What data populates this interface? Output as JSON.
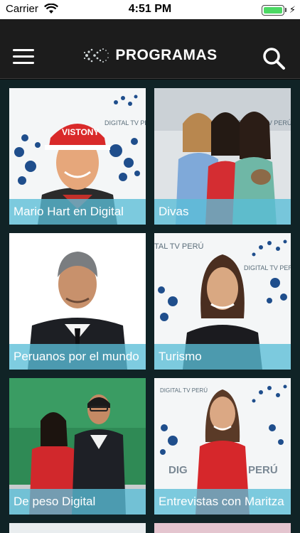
{
  "status_bar": {
    "carrier": "Carrier",
    "time": "4:51 PM",
    "battery_level": 1.0
  },
  "header": {
    "title": "PROGRAMAS",
    "menu_icon": "hamburger-icon",
    "search_icon": "search-icon"
  },
  "programs": [
    {
      "label": "Mario Hart en Digital",
      "watermark": "DIGITAL TV PERÚ"
    },
    {
      "label": "Divas",
      "watermark": "DIGITAL TV PERÚ"
    },
    {
      "label": "Peruanos por el mundo"
    },
    {
      "label": "Turismo",
      "watermark": "DIGITAL TV PERÚ"
    },
    {
      "label": "De peso Digital"
    },
    {
      "label": "Entrevistas con Maritza",
      "watermark": "DIGITAL TV PERÚ"
    }
  ],
  "colors": {
    "nav_bg": "#1c1c1c",
    "grid_bg": "#102326",
    "label_overlay": "#5abed7",
    "battery": "#4cd964"
  }
}
